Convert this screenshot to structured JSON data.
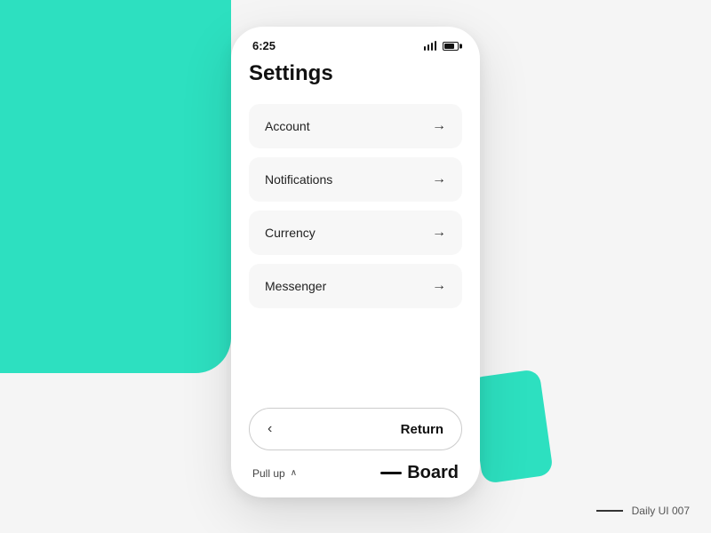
{
  "background": {
    "teal_color": "#2de0c0"
  },
  "phone": {
    "status_bar": {
      "time": "6:25"
    },
    "page_title": "Settings",
    "settings_items": [
      {
        "id": "account",
        "label": "Account"
      },
      {
        "id": "notifications",
        "label": "Notifications"
      },
      {
        "id": "currency",
        "label": "Currency"
      },
      {
        "id": "messenger",
        "label": "Messenger"
      }
    ],
    "return_button": {
      "label": "Return"
    },
    "footer": {
      "pull_up_label": "Pull up",
      "board_label": "Board"
    }
  },
  "watermark": {
    "label": "Daily UI 007"
  }
}
